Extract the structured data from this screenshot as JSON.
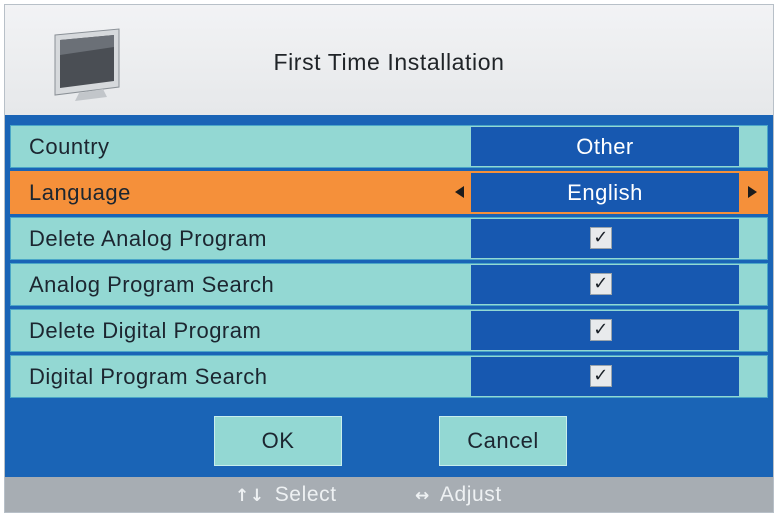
{
  "header": {
    "title": "First Time Installation",
    "icon": "tv-monitor-icon"
  },
  "settings": [
    {
      "label": "Country",
      "value": "Other",
      "type": "text",
      "selected": false
    },
    {
      "label": "Language",
      "value": "English",
      "type": "text",
      "selected": true
    },
    {
      "label": "Delete Analog Program",
      "value": "✓",
      "type": "checkbox",
      "checked": true,
      "selected": false
    },
    {
      "label": "Analog Program Search",
      "value": "✓",
      "type": "checkbox",
      "checked": true,
      "selected": false
    },
    {
      "label": "Delete Digital Program",
      "value": "✓",
      "type": "checkbox",
      "checked": true,
      "selected": false
    },
    {
      "label": "Digital Program Search",
      "value": "✓",
      "type": "checkbox",
      "checked": true,
      "selected": false
    }
  ],
  "buttons": {
    "ok_label": "OK",
    "cancel_label": "Cancel"
  },
  "footer": {
    "select_icon": "↑↓",
    "select_label": "Select",
    "adjust_icon": "↔",
    "adjust_label": "Adjust"
  },
  "colors": {
    "panel_blue": "#1a64b6",
    "row_teal": "#93d8d3",
    "value_blue": "#1758b0",
    "highlight_orange": "#f5903a",
    "footer_gray": "#a7adb3"
  }
}
